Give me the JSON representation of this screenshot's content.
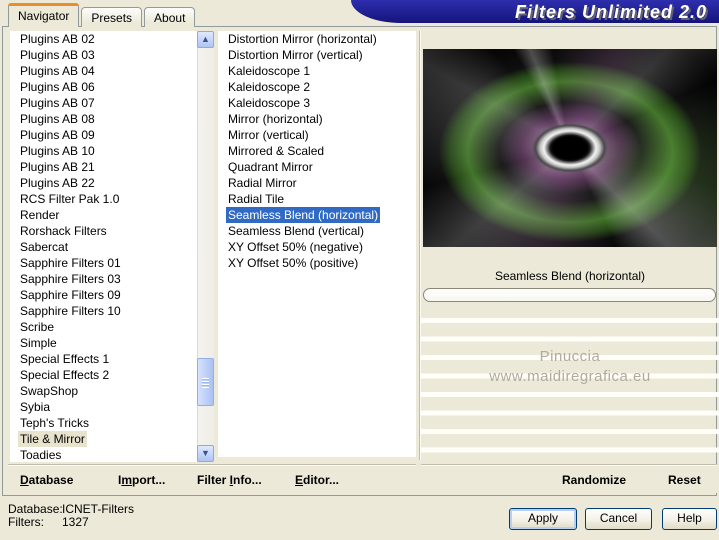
{
  "window": {
    "banner_title": "Filters Unlimited 2.0"
  },
  "tabs": {
    "navigator": "Navigator",
    "presets": "Presets",
    "about": "About"
  },
  "category_list": {
    "items": [
      "Plugins AB 02",
      "Plugins AB 03",
      "Plugins AB 04",
      "Plugins AB 06",
      "Plugins AB 07",
      "Plugins AB 08",
      "Plugins AB 09",
      "Plugins AB 10",
      "Plugins AB 21",
      "Plugins AB 22",
      "RCS Filter Pak 1.0",
      "Render",
      "Rorshack Filters",
      "Sabercat",
      "Sapphire Filters 01",
      "Sapphire Filters 03",
      "Sapphire Filters 09",
      "Sapphire Filters 10",
      "Scribe",
      "Simple",
      "Special Effects 1",
      "Special Effects 2",
      "SwapShop",
      "Sybia",
      "Teph's Tricks",
      "Tile & Mirror",
      "Toadies"
    ],
    "selected": "Tile & Mirror"
  },
  "filter_list": {
    "items": [
      "Distortion Mirror (horizontal)",
      "Distortion Mirror (vertical)",
      "Kaleidoscope 1",
      "Kaleidoscope 2",
      "Kaleidoscope 3",
      "Mirror (horizontal)",
      "Mirror (vertical)",
      "Mirrored & Scaled",
      "Quadrant Mirror",
      "Radial Mirror",
      "Radial Tile",
      "Seamless Blend (horizontal)",
      "Seamless Blend (vertical)",
      "XY Offset 50% (negative)",
      "XY Offset 50% (positive)"
    ],
    "selected": "Seamless Blend (horizontal)"
  },
  "preview": {
    "caption": "Seamless Blend (horizontal)",
    "watermark_line1": "Pinuccia",
    "watermark_line2": "www.maidiregrafica.eu"
  },
  "toolbar": {
    "database": {
      "pre": "",
      "accel": "D",
      "post": "atabase"
    },
    "import": {
      "pre": "I",
      "accel": "m",
      "post": "port..."
    },
    "filter_info": {
      "pre": "Filter ",
      "accel": "I",
      "post": "nfo..."
    },
    "editor": {
      "pre": "",
      "accel": "E",
      "post": "ditor..."
    },
    "randomize": "Randomize",
    "reset": "Reset"
  },
  "status": {
    "database_label": "Database:",
    "database_value": "ICNET-Filters",
    "filters_label": "Filters:",
    "filters_value": "1327"
  },
  "action_buttons": {
    "apply": "Apply",
    "cancel": "Cancel",
    "help": "Help"
  },
  "scrollbar": {
    "up_icon": "▲",
    "down_icon": "▼"
  },
  "colors": {
    "selection_blue": "#316ac5",
    "banner_navy": "#1c1c90",
    "tab_accent_orange": "#e5902a",
    "dialog_face": "#ece9d8"
  }
}
